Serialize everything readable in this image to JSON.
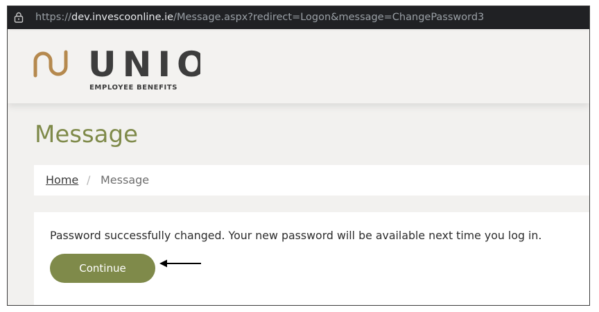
{
  "browser": {
    "url_scheme": "https://",
    "url_host": "dev.invescoonline.ie",
    "url_path": "/Message.aspx?redirect=Logon&message=ChangePassword3"
  },
  "header": {
    "logo_text": "UNIO",
    "logo_tagline": "EMPLOYEE BENEFITS",
    "logo_icon": "unio-logo-icon",
    "logo_mark_color": "#b5894e",
    "logo_text_color": "#3d3d3d"
  },
  "page": {
    "title": "Message",
    "accent_color": "#7f8a4a"
  },
  "breadcrumb": {
    "home": "Home",
    "separator": "/",
    "current": "Message"
  },
  "message": {
    "text": "Password successfully changed. Your new password will be available next time you log in.",
    "continue_label": "Continue"
  },
  "icons": {
    "lock": "lock-icon",
    "arrow": "arrow-left-icon"
  }
}
